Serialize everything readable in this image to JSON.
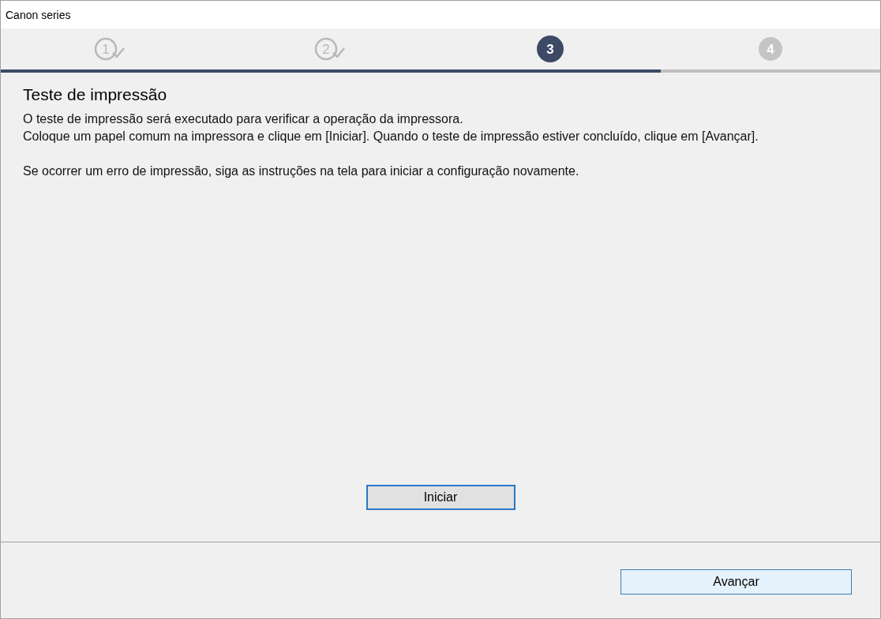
{
  "window": {
    "title": "Canon series"
  },
  "steps": [
    {
      "number": "1",
      "kind": "done"
    },
    {
      "number": "2",
      "kind": "done"
    },
    {
      "number": "3",
      "kind": "current"
    },
    {
      "number": "4",
      "kind": "pending"
    }
  ],
  "progress": {
    "level": 0.75
  },
  "page": {
    "heading": "Teste de impressão",
    "paragraphs": [
      "O teste de impressão será executado para verificar a operação da impressora.",
      "Coloque um papel comum na impressora e clique em [Iniciar]. Quando o teste de impressão estiver concluído, clique em [Avançar].",
      "Se ocorrer um erro de impressão, siga as instruções na tela para iniciar a configuração novamente."
    ]
  },
  "start_button": {
    "label": "Iniciar",
    "focused": true
  },
  "next_button": {
    "label": "Avançar",
    "hovered": true
  }
}
